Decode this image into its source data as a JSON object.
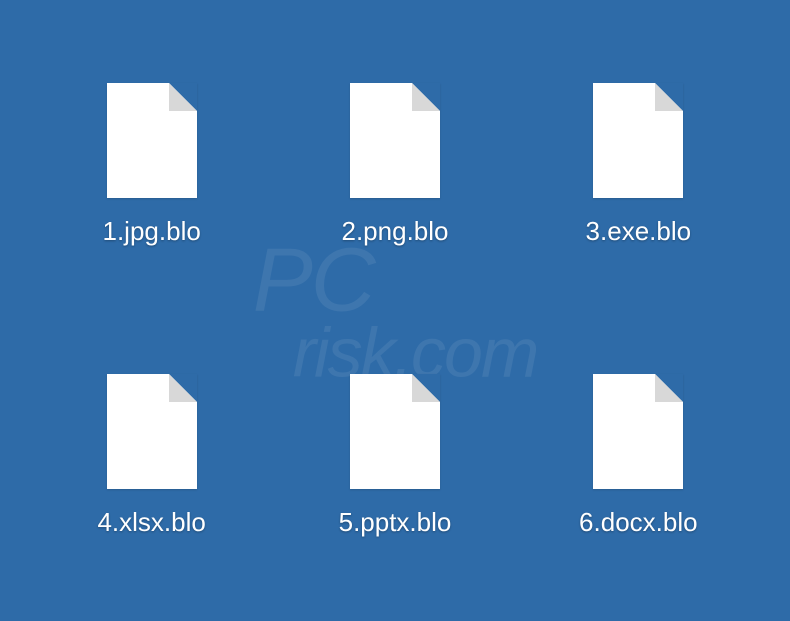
{
  "watermark": {
    "line1": "PC",
    "line2": "risk.com"
  },
  "files": [
    {
      "name": "1.jpg.blo"
    },
    {
      "name": "2.png.blo"
    },
    {
      "name": "3.exe.blo"
    },
    {
      "name": "4.xlsx.blo"
    },
    {
      "name": "5.pptx.blo"
    },
    {
      "name": "6.docx.blo"
    }
  ]
}
